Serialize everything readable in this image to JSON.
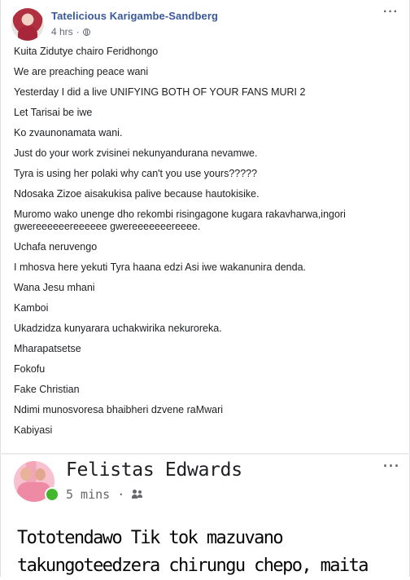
{
  "post1": {
    "author": "Tatelicious Karigambe-Sandberg",
    "time": "4 hrs",
    "separator": "·",
    "privacy_icon": "globe-icon",
    "more_label": "···",
    "lines": [
      "Kuita Zidutye chairo Feridhongo",
      "We are preaching peace wani",
      "Yesterday I did a live UNIFYING BOTH OF YOUR FANS MURI 2",
      "Let Tarisai be iwe",
      "Ko zvaunonamata wani.",
      "Just do your work zvisinei nekunyandurana nevamwe.",
      "Tyra is using her polaki why can't you use yours?????",
      "Ndosaka Zizoe aisakukisa palive because hautokisike.",
      "Muromo wako unenge dho rekombi risingagone kugara rakavharwa,ingori gwereeeeeereeeeee gwereeeeeeereeee.",
      "Uchafa neruvengo",
      "I mhosva here yekuti Tyra haana edzi Asi iwe wakanunira denda.",
      "Wana Jesu mhani",
      "Kamboi",
      "Ukadzidza kunyarara uchakwirika nekuroreka.",
      "Mharapatsetse",
      "Fokofu",
      "Fake Christian",
      "Ndimi munosvoresa bhaibheri dzvene raMwari",
      "Kabiyasi"
    ]
  },
  "post2": {
    "author": "Felistas Edwards",
    "time": "5 mins",
    "separator": "·",
    "audience_icon": "friends-icon",
    "more_label": "···",
    "text_lines": [
      "Tototendawo Tik tok mazuvano",
      "takungoteedzera chirungu chepo, maita"
    ]
  }
}
